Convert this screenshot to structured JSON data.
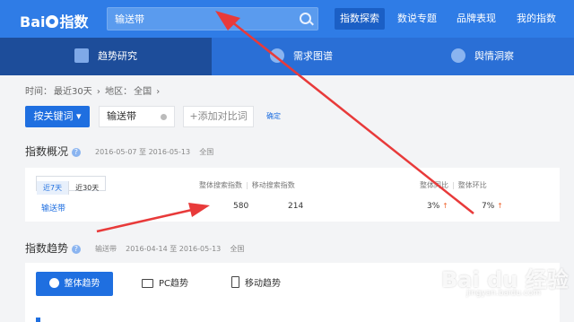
{
  "logo": {
    "text": "Baidu指数"
  },
  "search": {
    "value": "输送带"
  },
  "topnav": [
    {
      "label": "指数探索",
      "active": true
    },
    {
      "label": "数说专题"
    },
    {
      "label": "品牌表现"
    },
    {
      "label": "我的指数"
    }
  ],
  "tabs": [
    {
      "label": "趋势研究",
      "icon": "chart-area-icon",
      "active": true
    },
    {
      "label": "需求图谱",
      "icon": "bubble-icon"
    },
    {
      "label": "舆情洞察",
      "icon": "pie-icon"
    }
  ],
  "filters": {
    "time_label": "时间：",
    "time_value": "最近30天",
    "region_label": "地区：",
    "region_value": "全国"
  },
  "toolbar": {
    "search_kw_label": "按关键词",
    "keyword": "输送带",
    "add_compare_label": "+添加对比词",
    "confirm_label": "确定"
  },
  "overview": {
    "title": "指数概况",
    "date_from": "2016-05-07",
    "date_sep": "至",
    "date_to": "2016-05-13",
    "region": "全国",
    "range_tabs": [
      "近7天",
      "近30天"
    ],
    "headers": {
      "overall_search": "整体搜索指数",
      "mobile_search": "移动搜索指数",
      "yoy": "整体同比",
      "mom": "整体环比"
    },
    "row": {
      "keyword": "输送带",
      "overall_search": "580",
      "mobile_search": "214",
      "yoy": "3%",
      "mom": "7%",
      "arrow": "↑"
    }
  },
  "trend": {
    "title": "指数趋势",
    "keyword": "输送带",
    "date_from": "2016-04-14",
    "date_sep": "至",
    "date_to": "2016-05-13",
    "region": "全国",
    "buttons": [
      "整体趋势",
      "PC趋势",
      "移动趋势"
    ]
  },
  "watermark": {
    "text": "Bai du 经验",
    "sub": "jingyan.baidu.com"
  },
  "colors": {
    "topbar": "#2f7ce6",
    "tabs": "#2a6fd6",
    "accent": "#1f6fe0",
    "arrow": "#e83a3a"
  }
}
